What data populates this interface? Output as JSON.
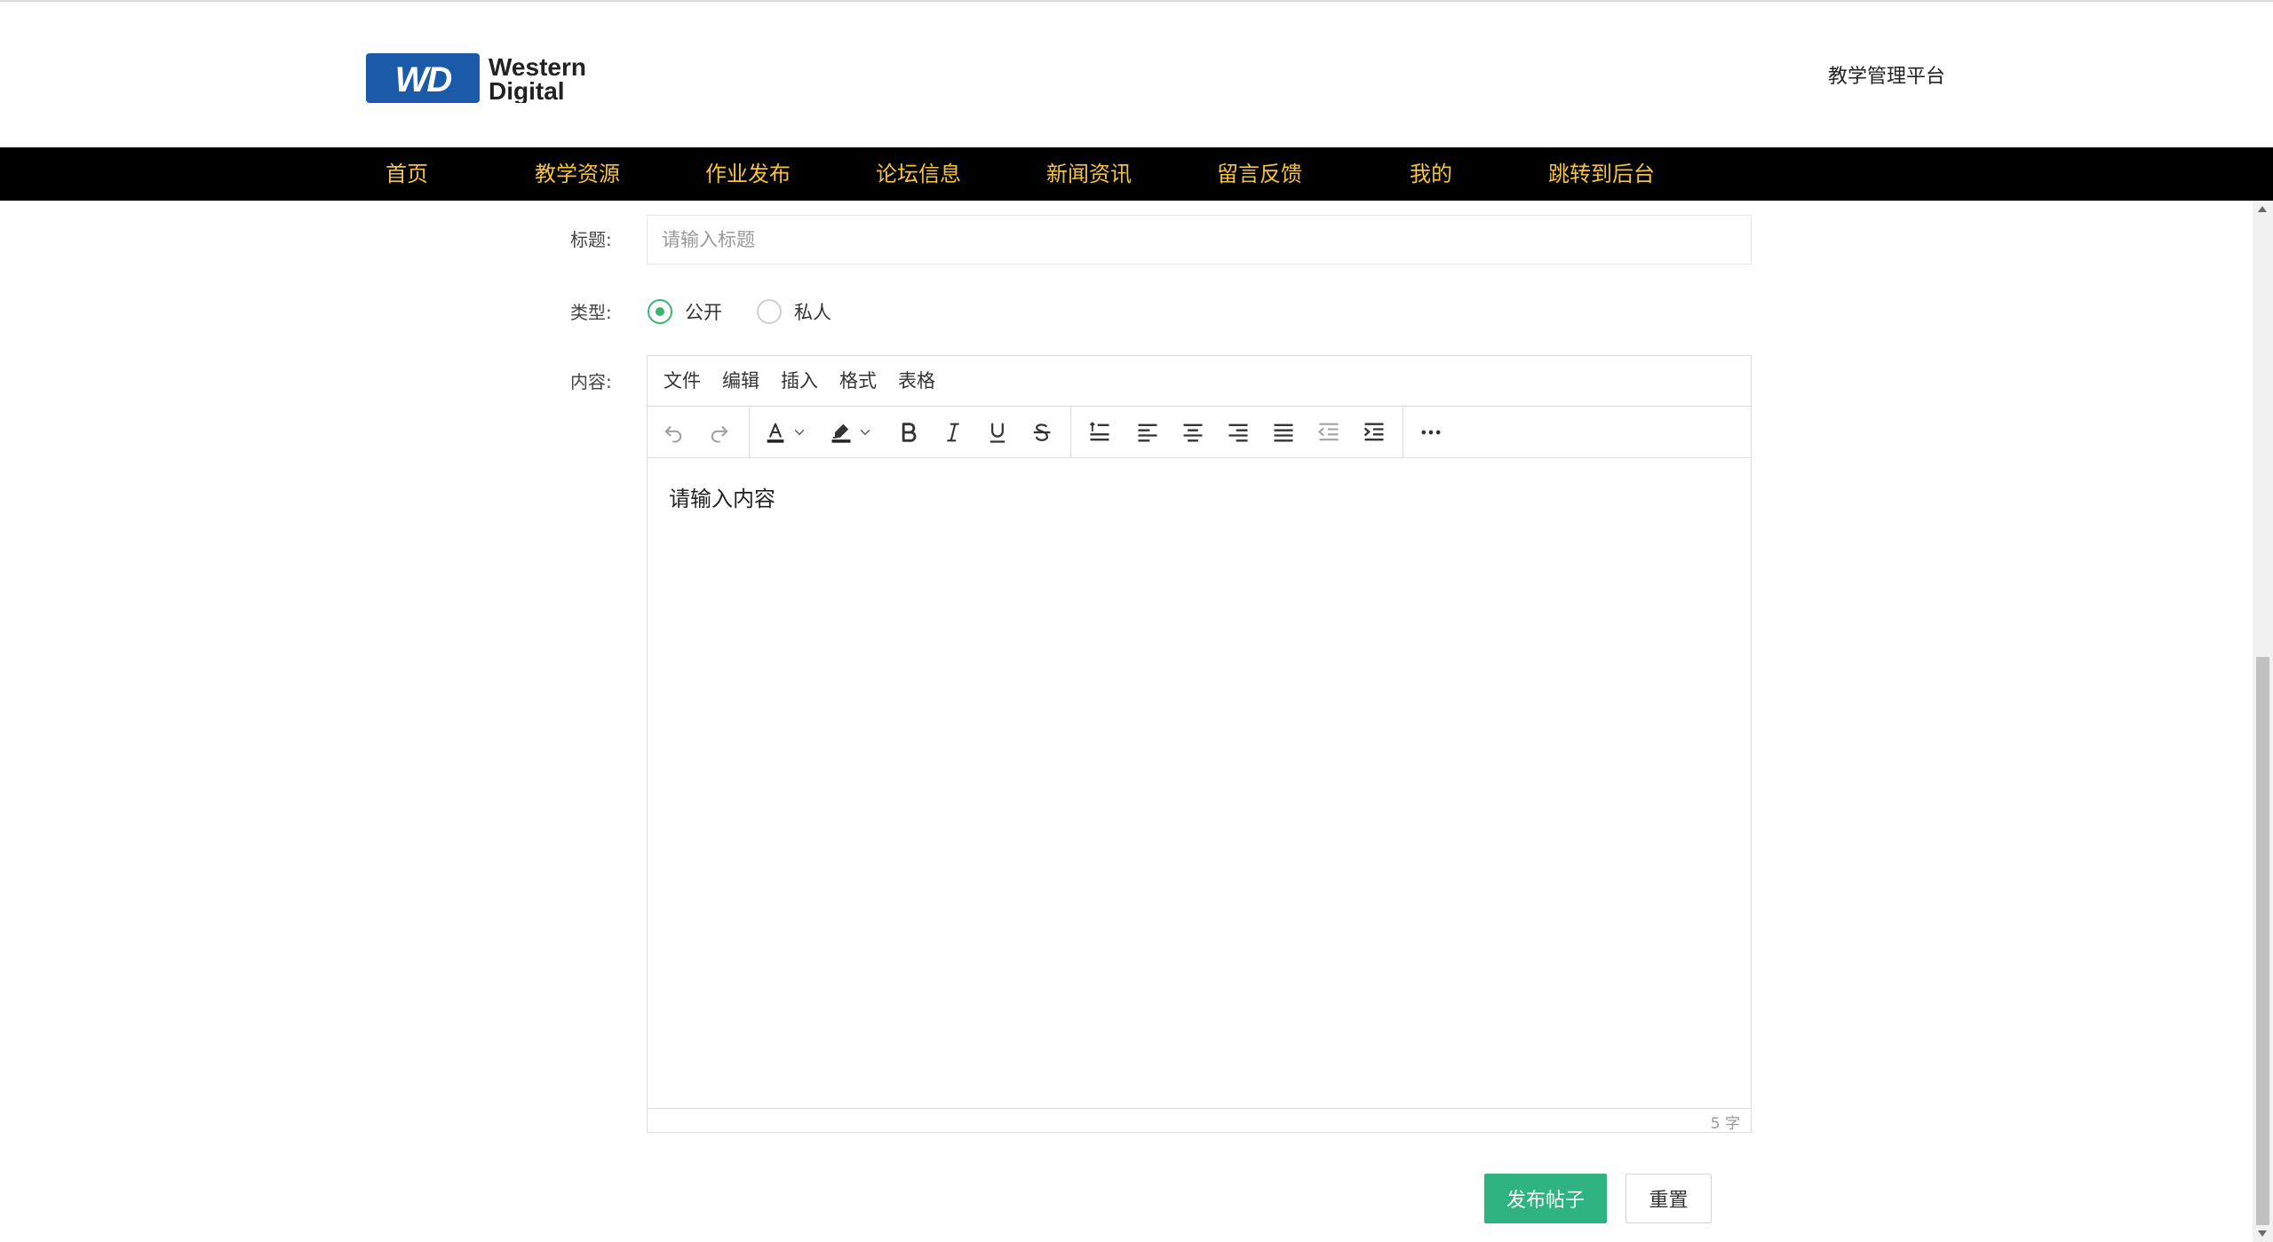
{
  "header": {
    "logo": {
      "mark": "WD",
      "line1": "Western",
      "line2": "Digital"
    },
    "platform_title": "教学管理平台"
  },
  "nav": {
    "items": [
      {
        "label": "首页"
      },
      {
        "label": "教学资源"
      },
      {
        "label": "作业发布"
      },
      {
        "label": "论坛信息"
      },
      {
        "label": "新闻资讯"
      },
      {
        "label": "留言反馈"
      },
      {
        "label": "我的"
      },
      {
        "label": "跳转到后台"
      }
    ]
  },
  "form": {
    "title_label": "标题:",
    "title_placeholder": "请输入标题",
    "title_value": "",
    "type_label": "类型:",
    "type_options": [
      {
        "label": "公开",
        "checked": true
      },
      {
        "label": "私人",
        "checked": false
      }
    ],
    "content_label": "内容:"
  },
  "editor": {
    "menus": [
      "文件",
      "编辑",
      "插入",
      "格式",
      "表格"
    ],
    "toolbar": [
      "undo-icon",
      "redo-icon",
      "font-color-icon",
      "highlight-icon",
      "bold-icon",
      "italic-icon",
      "underline-icon",
      "strikethrough-icon",
      "line-height-icon",
      "align-left-icon",
      "align-center-icon",
      "align-right-icon",
      "align-justify-icon",
      "outdent-icon",
      "indent-icon",
      "more-icon"
    ],
    "content": "请输入内容",
    "word_count": "5 字"
  },
  "buttons": {
    "submit": "发布帖子",
    "reset": "重置"
  },
  "colors": {
    "nav_bg": "#000000",
    "nav_text": "#f5c242",
    "accent_green": "#2fb380",
    "radio_green": "#3cb371",
    "logo_blue": "#1a5aa8"
  }
}
